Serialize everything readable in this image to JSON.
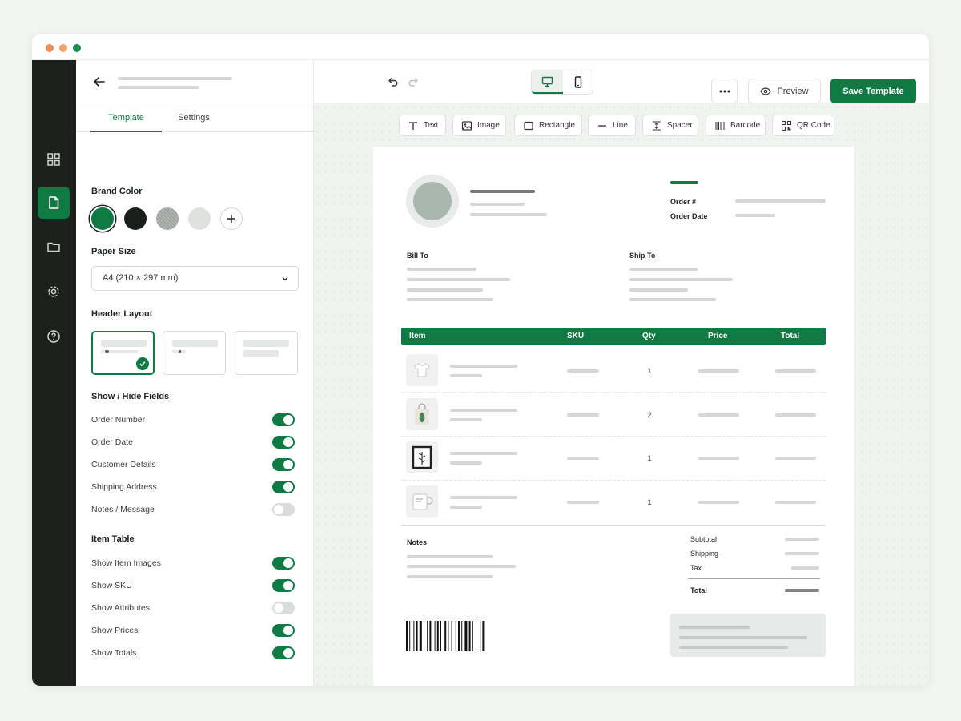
{
  "colors": {
    "brand": "#107a45",
    "dark": "#1c211e",
    "mac_red": "#f28b58",
    "mac_yellow": "#f5a26a",
    "mac_green": "#1d8a50"
  },
  "tabs": {
    "template": "Template",
    "settings": "Settings"
  },
  "brand_color": {
    "title": "Brand Color",
    "swatches": [
      "#107a45",
      "#1b1f1c",
      "#9ea4a0",
      "#dfe1df"
    ],
    "selected": 0
  },
  "paper_size": {
    "title": "Paper Size",
    "value": "A4  (210 × 297 mm)"
  },
  "header_layout": {
    "title": "Header Layout",
    "selected": 0
  },
  "show_hide": {
    "title": "Show / Hide Fields",
    "fields": [
      {
        "label": "Order Number",
        "on": true
      },
      {
        "label": "Order Date",
        "on": true
      },
      {
        "label": "Customer Details",
        "on": true
      },
      {
        "label": "Shipping Address",
        "on": true
      },
      {
        "label": "Notes / Message",
        "on": false
      }
    ]
  },
  "item_table": {
    "title": "Item Table",
    "fields": [
      {
        "label": "Show Item Images",
        "on": true
      },
      {
        "label": "Show SKU",
        "on": true
      },
      {
        "label": "Show Attributes",
        "on": false
      },
      {
        "label": "Show Prices",
        "on": true
      },
      {
        "label": "Show Totals",
        "on": true
      }
    ]
  },
  "toolbar": {
    "tools": [
      {
        "label": "Text",
        "icon": "text-icon"
      },
      {
        "label": "Image",
        "icon": "image-icon"
      },
      {
        "label": "Rectangle",
        "icon": "rectangle-icon"
      },
      {
        "label": "Line",
        "icon": "line-icon"
      },
      {
        "label": "Spacer",
        "icon": "spacer-icon"
      },
      {
        "label": "Barcode",
        "icon": "barcode-icon"
      },
      {
        "label": "QR Code",
        "icon": "qr-code-icon"
      }
    ],
    "preview": "Preview",
    "save": "Save Template"
  },
  "invoice": {
    "order_number_label": "Order #",
    "order_date_label": "Order Date",
    "bill_to": "Bill To",
    "ship_to": "Ship To",
    "columns": [
      "Item",
      "SKU",
      "Qty",
      "Price",
      "Total"
    ],
    "items": [
      {
        "qty": "1",
        "icon": "tshirt-icon"
      },
      {
        "qty": "2",
        "icon": "tote-bag-icon"
      },
      {
        "qty": "1",
        "icon": "framed-print-icon"
      },
      {
        "qty": "1",
        "icon": "mug-icon"
      }
    ],
    "notes": "Notes",
    "subtotal": "Subtotal",
    "shipping": "Shipping",
    "tax": "Tax",
    "total": "Total"
  }
}
